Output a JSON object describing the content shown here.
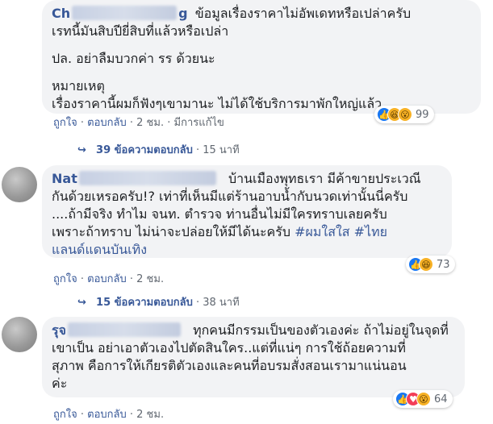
{
  "comments": [
    {
      "name": "Ch",
      "name_suffix": "g",
      "lines": [
        "ข้อมูลเรื่องราคาไม่อัพเดทหรือเปล่าครับ",
        "เรทนี้มันสิบปียี่สิบที่แล้วหรือเปล่า",
        "",
        "ปล. อย่าลืมบวกค่า รร ด้วยนะ",
        "",
        "หมายเหตุ",
        "เรื่องราคานี้ผมก็ฟังๆเขามานะ ไม่ได้ใช้บริการมาพักใหญ่แล้ว"
      ],
      "reaction_count": "99",
      "reactions": [
        "like-icon",
        "haha-icon",
        "wow-icon"
      ],
      "like_label": "ถูกใจ",
      "reply_label": "ตอบกลับ",
      "time": "2 ชม.",
      "edited": "มีการแก้ไข",
      "replies_text": "39 ข้อความตอบกลับ",
      "replies_time": "15 นาที"
    },
    {
      "name": "Nat",
      "lines": [
        "บ้านเมืองพุทธเรา มีค้าขายประเวณี",
        "กันด้วยเหรอครับ!? เท่าที่เห็นมีแต่ร้านอาบน้ำกับนวดเท่านั้นนี่ครับ",
        "....ถ้ามีจริง ทำไม จนท. ตำรวจ ท่านอื่นไม่มีใครทราบเลยครับ",
        "เพราะถ้าทราบ ไม่น่าจะปล่อยให้มีได้นะครับ",
        "แลนด์แดนบันเทิง"
      ],
      "hashtag1": "#ผมใสใส",
      "hashtag2": "#ไทย",
      "reaction_count": "73",
      "reactions": [
        "like-icon",
        "haha-icon"
      ],
      "like_label": "ถูกใจ",
      "reply_label": "ตอบกลับ",
      "time": "2 ชม.",
      "replies_text": "15 ข้อความตอบกลับ",
      "replies_time": "38 นาที"
    },
    {
      "name": "รุจ",
      "lines": [
        "ทุกคนมีกรรมเป็นของตัวเองค่ะ ถ้าไม่อยู่ในจุดที่",
        "เขาเป็น อย่าเอาตัวเองไปตัดสินใคร..แต่ที่แน่ๆ การใช้ถ้อยความที่",
        "สุภาพ คือการให้เกียรติตัวเองและคนที่อบรมสั่งสอนเรามาแน่นอน",
        "ค่ะ"
      ],
      "reaction_count": "64",
      "reactions": [
        "like-icon",
        "love-icon",
        "wow-icon"
      ],
      "like_label": "ถูกใจ",
      "reply_label": "ตอบกลับ",
      "time": "2 ชม."
    }
  ],
  "separator": "·",
  "colors": {
    "link": "#385898",
    "bubble": "#f2f3f5",
    "meta": "#606770"
  }
}
